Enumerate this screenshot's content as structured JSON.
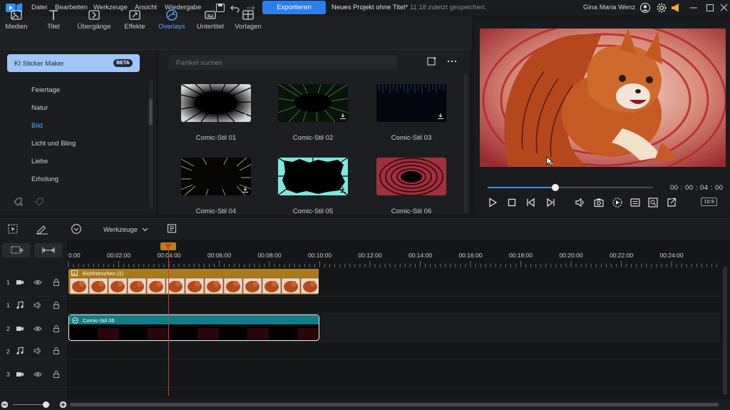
{
  "menu": {
    "items": [
      "Datei",
      "Bearbeiten",
      "Werkzeuge",
      "Ansicht",
      "Wiedergabe"
    ],
    "export_label": "Exportieren",
    "project_title": "Neues Projekt ohne Titel*",
    "project_saved": "11:18 zuletzt gespeichert.",
    "user_name": "Gina Maria Wenz"
  },
  "tool_tabs": [
    {
      "label": "Medien",
      "icon": "media-icon"
    },
    {
      "label": "Titel",
      "icon": "title-icon"
    },
    {
      "label": "Übergänge",
      "icon": "transitions-icon"
    },
    {
      "label": "Effekte",
      "icon": "effects-icon"
    },
    {
      "label": "Overlays",
      "icon": "overlays-icon",
      "active": true
    },
    {
      "label": "Untertitel",
      "icon": "subtitles-icon"
    },
    {
      "label": "Vorlagen",
      "icon": "templates-icon"
    }
  ],
  "sidebar": {
    "sticker_label": "KI Sticker Maker",
    "beta_badge": "BETA",
    "categories": [
      "Feiertage",
      "Natur",
      "Bild",
      "Licht und Bling",
      "Liebe",
      "Erholung"
    ],
    "active_category": "Bild"
  },
  "search": {
    "placeholder": "Partikel suchen"
  },
  "overlays": [
    {
      "label": "Comic-Stil 01"
    },
    {
      "label": "Comic-Stil 02"
    },
    {
      "label": "Comic-Stil 03"
    },
    {
      "label": "Comic-Stil 04"
    },
    {
      "label": "Comic-Stil 05"
    },
    {
      "label": "Comic-Stil 06"
    }
  ],
  "preview": {
    "timecode": "00 : 00 : 04 : 00",
    "aspect_ratio": "16:9",
    "progress": 0.41
  },
  "timeline": {
    "tools_label": "Werkzeuge",
    "ruler_labels": [
      "0:00",
      "00:02:00",
      "00:04:00",
      "00:06:00",
      "00:08:00",
      "00:10:00",
      "00:12:00",
      "00:14:00",
      "00:16:00",
      "00:18:00",
      "00:20:00",
      "00:22:00",
      "00:24:00"
    ],
    "tracks": [
      {
        "number": "1",
        "type": "video"
      },
      {
        "number": "1",
        "type": "audio"
      },
      {
        "number": "2",
        "type": "video"
      },
      {
        "number": "2",
        "type": "audio"
      },
      {
        "number": "3",
        "type": "video"
      }
    ],
    "clips": {
      "video_clip": "Eichhörnchen (1)",
      "overlay_clip": "Comic-Stil 06"
    }
  },
  "colors": {
    "accent": "#2d7ee8",
    "active_tab": "#5aa8ff",
    "video_clip": "#b68320",
    "overlay_clip": "#147c84",
    "playhead": "#d03a3a"
  }
}
